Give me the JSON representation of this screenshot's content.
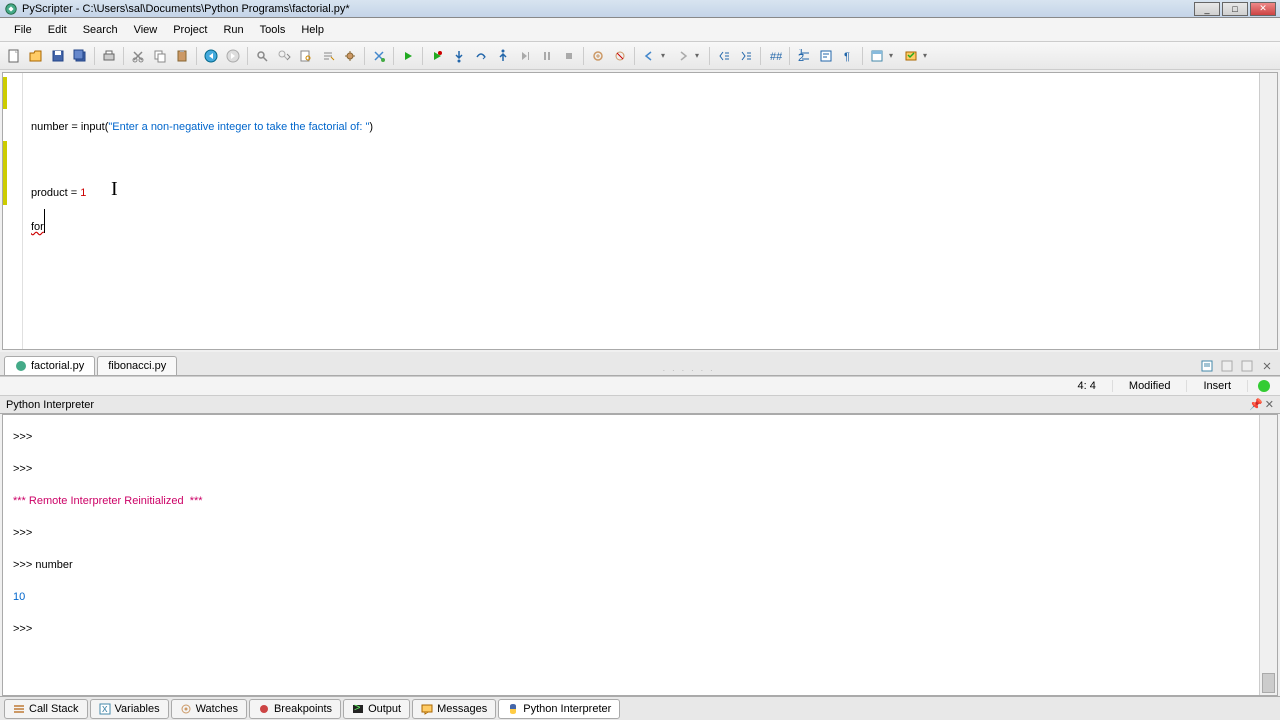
{
  "titlebar": {
    "text": "PyScripter - C:\\Users\\sal\\Documents\\Python Programs\\factorial.py*"
  },
  "menu": {
    "items": [
      "File",
      "Edit",
      "Search",
      "View",
      "Project",
      "Run",
      "Tools",
      "Help"
    ]
  },
  "code": {
    "line1_a": "number ",
    "line1_b": "=",
    "line1_c": " input",
    "line1_d": "(",
    "line1_e": "\"Enter a non-negative integer to take the factorial of: \"",
    "line1_f": ")",
    "line3_a": "product ",
    "line3_b": "=",
    "line3_c": " ",
    "line3_d": "1",
    "line4_a": "for"
  },
  "tabs": {
    "active": "factorial.py",
    "other": "fibonacci.py"
  },
  "status": {
    "pos": "4: 4",
    "modified": "Modified",
    "insert": "Insert"
  },
  "panel": {
    "title": "Python Interpreter"
  },
  "console": {
    "l1": ">>>",
    "l2": ">>>",
    "l3": "*** Remote Interpreter Reinitialized  ***",
    "l4": ">>>",
    "l5a": ">>> ",
    "l5b": "number",
    "l6": "10",
    "l7": ">>>"
  },
  "bottom_tabs": {
    "t1": "Call Stack",
    "t2": "Variables",
    "t3": "Watches",
    "t4": "Breakpoints",
    "t5": "Output",
    "t6": "Messages",
    "t7": "Python Interpreter"
  }
}
